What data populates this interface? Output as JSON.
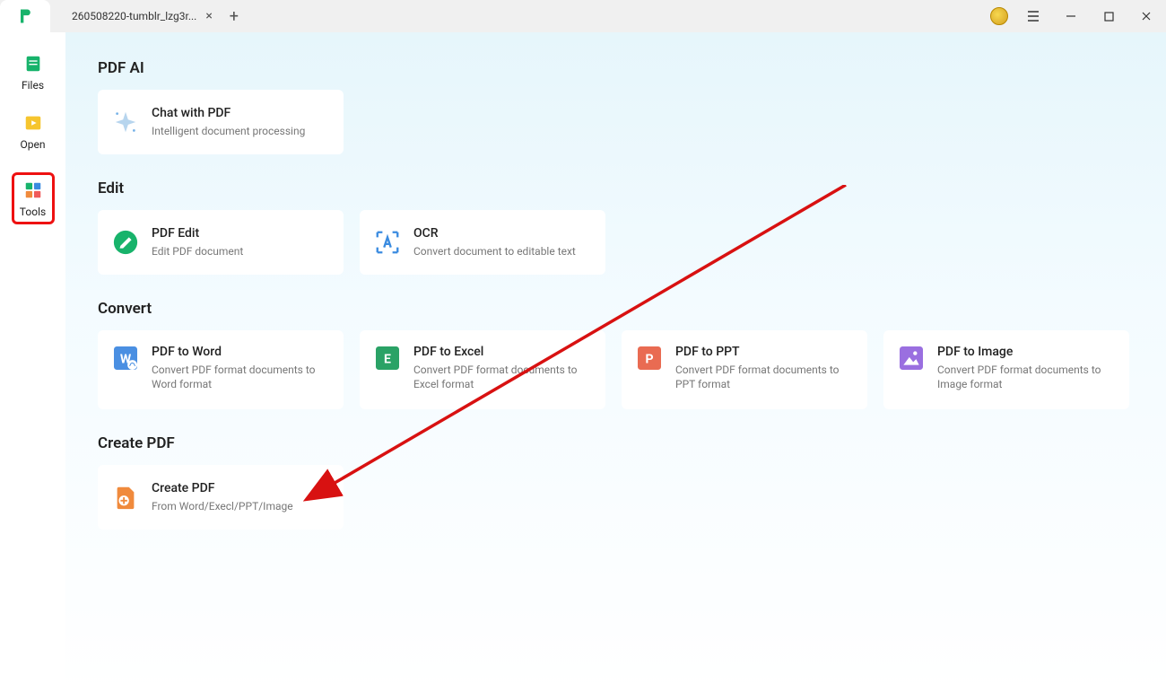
{
  "titlebar": {
    "tab_title": "260508220-tumblr_lzg3r..."
  },
  "sidebar": {
    "items": [
      {
        "label": "Files"
      },
      {
        "label": "Open"
      },
      {
        "label": "Tools"
      }
    ]
  },
  "sections": {
    "pdf_ai": {
      "title": "PDF AI",
      "cards": [
        {
          "title": "Chat with PDF",
          "desc": "Intelligent document processing"
        }
      ]
    },
    "edit": {
      "title": "Edit",
      "cards": [
        {
          "title": "PDF Edit",
          "desc": "Edit PDF document"
        },
        {
          "title": "OCR",
          "desc": "Convert document to editable text"
        }
      ]
    },
    "convert": {
      "title": "Convert",
      "cards": [
        {
          "title": "PDF to Word",
          "desc": "Convert PDF format documents to Word format"
        },
        {
          "title": "PDF to Excel",
          "desc": "Convert PDF format documents to Excel format"
        },
        {
          "title": "PDF to PPT",
          "desc": "Convert PDF format documents to PPT format"
        },
        {
          "title": "PDF to Image",
          "desc": "Convert PDF format documents to Image format"
        }
      ]
    },
    "create": {
      "title": "Create PDF",
      "cards": [
        {
          "title": "Create PDF",
          "desc": "From Word/Execl/PPT/Image"
        }
      ]
    }
  }
}
